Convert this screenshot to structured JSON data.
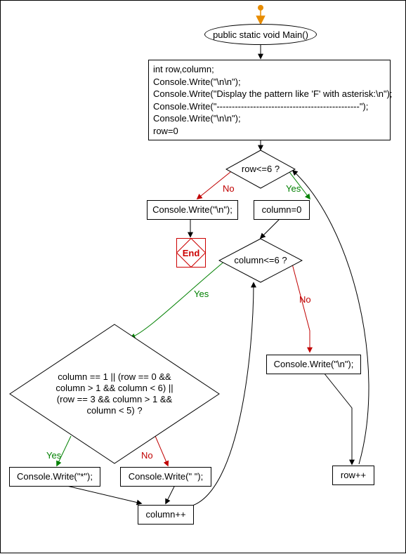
{
  "diagram": {
    "type": "flowchart",
    "start_label": "public static void Main()",
    "init_block": "int row,column;\nConsole.Write(\"\\n\\n\");\nConsole.Write(\"Display the pattern like 'F' with asterisk:\\n\");\nConsole.Write(\"-----------------------------------------------\");\nConsole.Write(\"\\n\\n\");\nrow=0",
    "dec_row": "row<=6 ?",
    "dec_column": "column<=6 ?",
    "dec_condition": "column == 1 || (row == 0 && column > 1 && column < 6) || (row == 3 && column > 1 && column < 5) ?",
    "act_write_nl_row_end": "Console.Write(\"\\n\");",
    "act_column_zero": "column=0",
    "act_write_star": "Console.Write(\"*\");",
    "act_write_space": "Console.Write(\" \");",
    "act_column_pp": "column++",
    "act_write_nl_col_end": "Console.Write(\"\\n\");",
    "act_row_pp": "row++",
    "end_label": "End",
    "labels": {
      "yes": "Yes",
      "no": "No"
    }
  }
}
